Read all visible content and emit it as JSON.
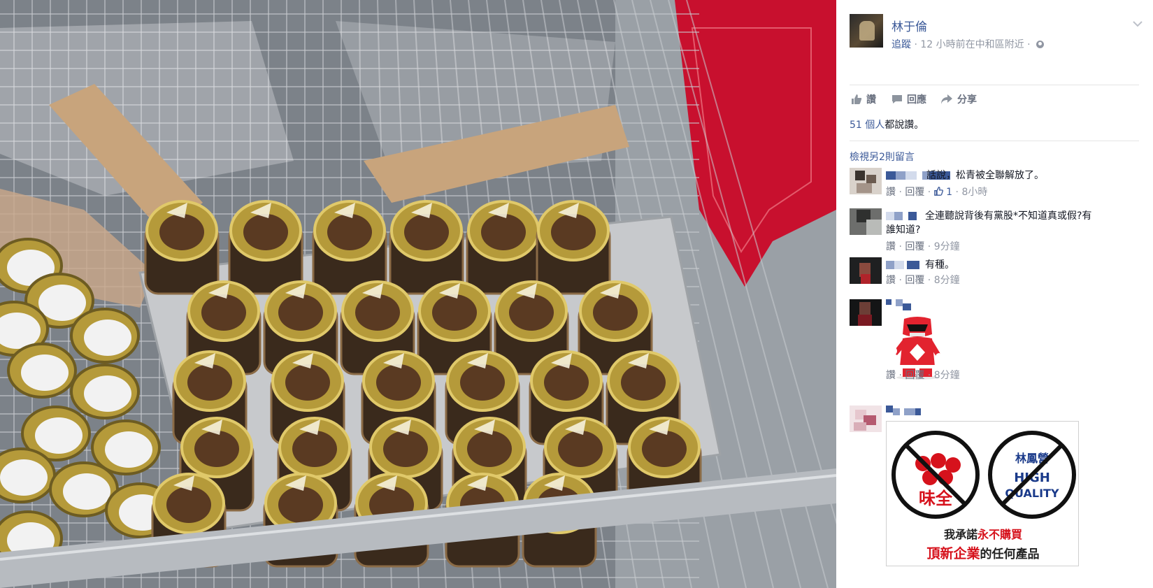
{
  "post": {
    "author": "林于倫",
    "follow_label": "追蹤",
    "meta_text": " · 12 小時前在中和區附近 · ",
    "actions": {
      "like": "讚",
      "comment": "回應",
      "share": "分享"
    },
    "likes": {
      "count": "51 個人",
      "suffix": "都說讚。"
    },
    "view_more_comments": "檢視另2則留言"
  },
  "comments": [
    {
      "text": "話說，松青被全聯解放了。",
      "like_label": "讚",
      "reply_label": "回覆",
      "like_count": "1",
      "time": "8小時"
    },
    {
      "text_line1": "全連聽說背後有黨股*不知道真或假?有",
      "text_line2": "誰知道?",
      "like_label": "讚",
      "reply_label": "回覆",
      "time": "9分鐘"
    },
    {
      "text": "有種。",
      "like_label": "讚",
      "reply_label": "回覆",
      "time": "8分鐘"
    },
    {
      "like_label": "讚",
      "reply_label": "回覆",
      "time": "8分鐘",
      "sticker": "power-ranger-thumbs-up"
    },
    {
      "boycott": {
        "left_logo_text": "味全",
        "right_logo_text_top": "林鳳營",
        "right_logo_text_mid": "HIGH",
        "right_logo_text_bottom": "QUALITY",
        "line1_prefix": "我承諾",
        "line1_red": "永不購買",
        "line2_red": "頂新企業",
        "line2_suffix": "的任何產品"
      }
    }
  ],
  "colors": {
    "link_blue": "#3b5998",
    "meta_grey": "#9197a3",
    "cart_red": "#c8102e",
    "lid_gold": "#b59a3a"
  }
}
